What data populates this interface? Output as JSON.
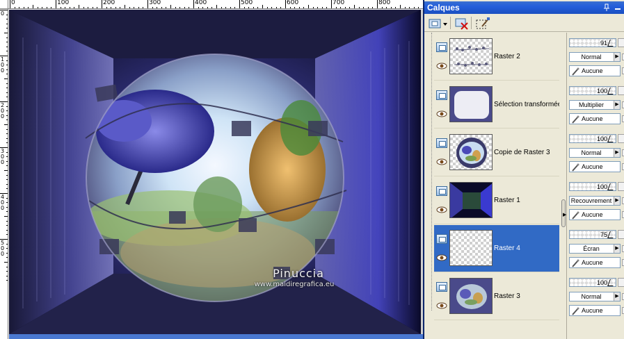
{
  "ruler": {
    "top_labels": [
      "0",
      "100",
      "200",
      "300",
      "400",
      "500",
      "600",
      "700",
      "800"
    ],
    "left_labels": [
      "0",
      "100",
      "200",
      "300",
      "400",
      "500"
    ]
  },
  "canvas": {
    "signature": "Pinuccia",
    "url": "www.maidiregrafica.eu"
  },
  "panel": {
    "title": "Calques",
    "pin_icon": "pin-icon",
    "min_icon": "minimize-icon",
    "toolbar": [
      {
        "name": "new-layer-button",
        "icon": "new-layer-icon"
      },
      {
        "name": "delete-layer-button",
        "icon": "delete-layer-icon"
      },
      {
        "name": "new-mask-button",
        "icon": "mask-icon"
      }
    ],
    "layers": [
      {
        "name": "Raster 2",
        "opacity": "91",
        "blend": "Normal",
        "link": "Aucune",
        "selected": false,
        "thumb": "stitches"
      },
      {
        "name": "Sélection transformée",
        "opacity": "100",
        "blend": "Multiplier",
        "link": "Aucune",
        "selected": false,
        "thumb": "frame"
      },
      {
        "name": "Copie de Raster 3",
        "opacity": "100",
        "blend": "Normal",
        "link": "Aucune",
        "selected": false,
        "thumb": "orb"
      },
      {
        "name": "Raster 1",
        "opacity": "100",
        "blend": "Recouvrement",
        "link": "Aucune",
        "selected": false,
        "thumb": "room"
      },
      {
        "name": "Raster 4",
        "opacity": "75",
        "blend": "Écran",
        "link": "Aucune",
        "selected": true,
        "thumb": "empty"
      },
      {
        "name": "Raster 3",
        "opacity": "100",
        "blend": "Normal",
        "link": "Aucune",
        "selected": false,
        "thumb": "blur"
      }
    ]
  },
  "colors": {
    "selection": "#316ac5",
    "title_bar": "#245edb",
    "panel_bg": "#ece9d8"
  }
}
